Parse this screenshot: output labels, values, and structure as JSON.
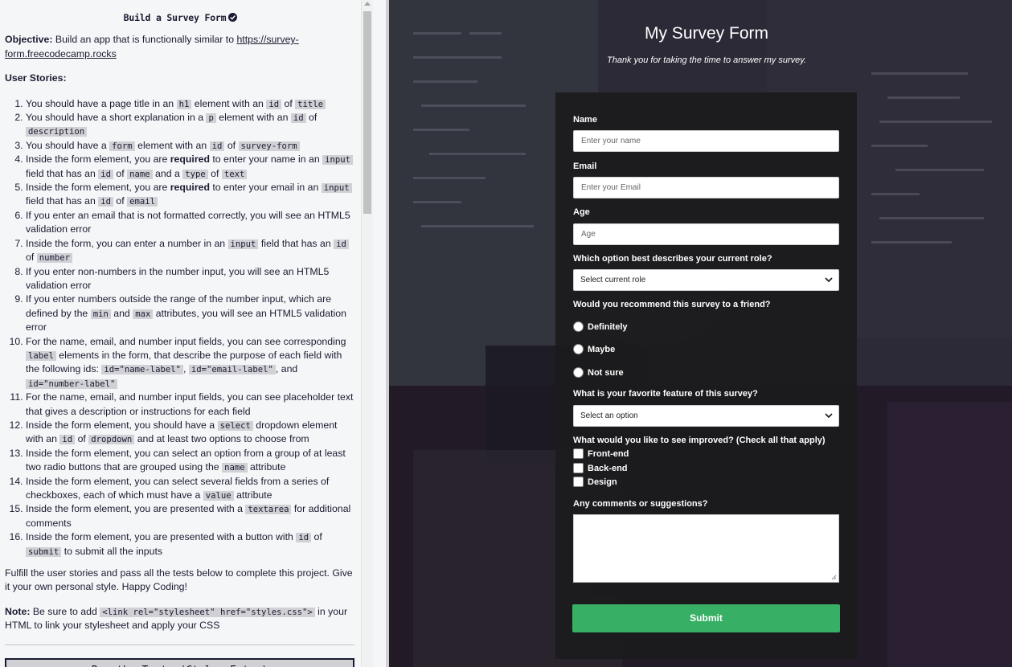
{
  "challenge": {
    "title": "Build a Survey Form",
    "objective_label": "Objective:",
    "objective_text": " Build an app that is functionally similar to ",
    "objective_link": "https://survey-form.freecodecamp.rocks",
    "stories_heading": "User Stories:",
    "stories": [
      [
        "You should have a page title in an ",
        {
          "c": "h1"
        },
        " element with an ",
        {
          "c": "id"
        },
        " of ",
        {
          "c": "title"
        }
      ],
      [
        "You should have a short explanation in a ",
        {
          "c": "p"
        },
        " element with an ",
        {
          "c": "id"
        },
        " of ",
        {
          "c": "description"
        }
      ],
      [
        "You should have a ",
        {
          "c": "form"
        },
        " element with an ",
        {
          "c": "id"
        },
        " of ",
        {
          "c": "survey-form"
        }
      ],
      [
        "Inside the form element, you are ",
        {
          "b": "required"
        },
        " to enter your name in an ",
        {
          "c": "input"
        },
        " field that has an ",
        {
          "c": "id"
        },
        " of ",
        {
          "c": "name"
        },
        " and a ",
        {
          "c": "type"
        },
        " of ",
        {
          "c": "text"
        }
      ],
      [
        "Inside the form element, you are ",
        {
          "b": "required"
        },
        " to enter your email in an ",
        {
          "c": "input"
        },
        " field that has an ",
        {
          "c": "id"
        },
        " of ",
        {
          "c": "email"
        }
      ],
      [
        "If you enter an email that is not formatted correctly, you will see an HTML5 validation error"
      ],
      [
        "Inside the form, you can enter a number in an ",
        {
          "c": "input"
        },
        " field that has an ",
        {
          "c": "id"
        },
        " of ",
        {
          "c": "number"
        }
      ],
      [
        "If you enter non-numbers in the number input, you will see an HTML5 validation error"
      ],
      [
        "If you enter numbers outside the range of the number input, which are defined by the ",
        {
          "c": "min"
        },
        " and ",
        {
          "c": "max"
        },
        " attributes, you will see an HTML5 validation error"
      ],
      [
        "For the name, email, and number input fields, you can see corresponding ",
        {
          "c": "label"
        },
        " elements in the form, that describe the purpose of each field with the following ids: ",
        {
          "c": "id=\"name-label\""
        },
        ", ",
        {
          "c": "id=\"email-label\""
        },
        ", and ",
        {
          "c": "id=\"number-label\""
        }
      ],
      [
        "For the name, email, and number input fields, you can see placeholder text that gives a description or instructions for each field"
      ],
      [
        "Inside the form element, you should have a ",
        {
          "c": "select"
        },
        " dropdown element with an ",
        {
          "c": "id"
        },
        " of ",
        {
          "c": "dropdown"
        },
        " and at least two options to choose from"
      ],
      [
        "Inside the form element, you can select an option from a group of at least two radio buttons that are grouped using the ",
        {
          "c": "name"
        },
        " attribute"
      ],
      [
        "Inside the form element, you can select several fields from a series of checkboxes, each of which must have a ",
        {
          "c": "value"
        },
        " attribute"
      ],
      [
        "Inside the form element, you are presented with a ",
        {
          "c": "textarea"
        },
        " for additional comments"
      ],
      [
        "Inside the form element, you are presented with a button with ",
        {
          "c": "id"
        },
        " of ",
        {
          "c": "submit"
        },
        " to submit all the inputs"
      ]
    ],
    "fulfill_text": "Fulfill the user stories and pass all the tests below to complete this project. Give it your own personal style. Happy Coding!",
    "note_label": "Note:",
    "note_pre": " Be sure to add ",
    "note_code": "<link rel=\"stylesheet\" href=\"styles.css\">",
    "note_post": " in your HTML to link your stylesheet and apply your CSS",
    "run_button": "Run the Tests (Ctrl + Enter)"
  },
  "preview": {
    "title": "My Survey Form",
    "description": "Thank you for taking the time to answer my survey.",
    "form": {
      "name_label": "Name",
      "name_placeholder": "Enter your name",
      "email_label": "Email",
      "email_placeholder": "Enter your Email",
      "age_label": "Age",
      "age_placeholder": "Age",
      "role_label": "Which option best describes your current role?",
      "role_selected": "Select current role",
      "recommend_label": "Would you recommend this survey to a friend?",
      "radio_options": [
        "Definitely",
        "Maybe",
        "Not sure"
      ],
      "feature_label": "What is your favorite feature of this survey?",
      "feature_selected": "Select an option",
      "improve_label": "What would you like to see improved? (Check all that apply)",
      "checkbox_options": [
        "Front-end",
        "Back-end",
        "Design"
      ],
      "comments_label": "Any comments or suggestions?",
      "submit_label": "Submit"
    },
    "colors": {
      "submit_bg": "#37af65",
      "form_bg": "#1b1b1d"
    }
  }
}
